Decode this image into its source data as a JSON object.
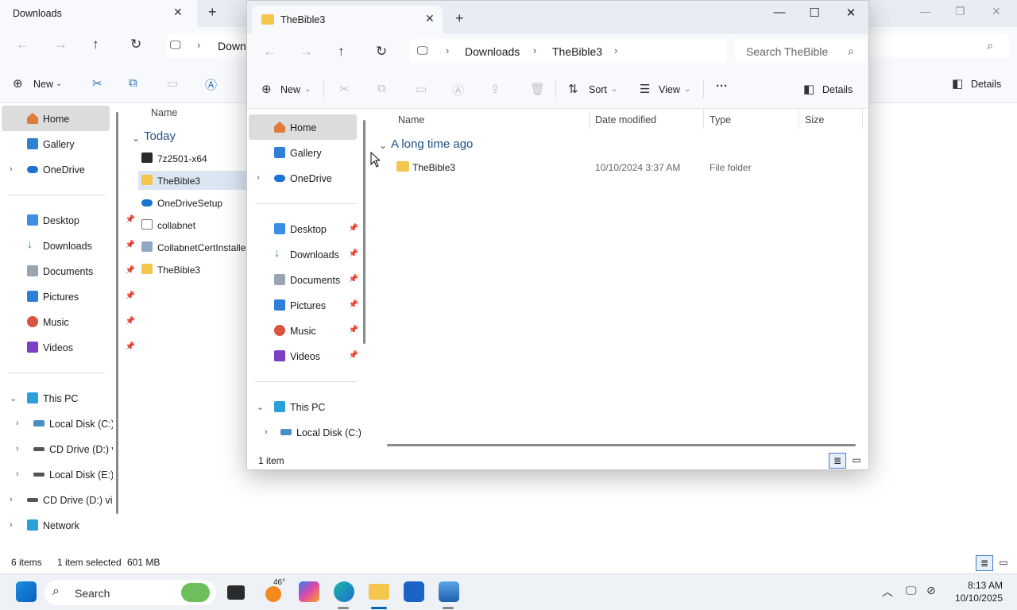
{
  "background_window": {
    "tab_title": "Downloads",
    "address_text": "Down",
    "toolbar": {
      "new_label": "New",
      "details_label": "Details"
    },
    "sidebar": {
      "home": "Home",
      "gallery": "Gallery",
      "onedrive": "OneDrive",
      "pinned": [
        "Desktop",
        "Downloads",
        "Documents",
        "Pictures",
        "Music",
        "Videos"
      ],
      "this_pc": "This PC",
      "drives": [
        "Local Disk (C:)",
        "CD Drive (D:) v",
        "Local Disk (E:)",
        "CD Drive (D:) vir"
      ],
      "network": "Network"
    },
    "list": {
      "column_name": "Name",
      "group": "Today",
      "files": [
        "7z2501-x64",
        "TheBible3",
        "OneDriveSetup",
        "collabnet",
        "CollabnetCertInstaller",
        "TheBible3"
      ]
    },
    "status": {
      "items": "6 items",
      "selected": "1 item selected",
      "size": "601 MB"
    }
  },
  "front_window": {
    "tab_title": "TheBible3",
    "breadcrumb": [
      "Downloads",
      "TheBible3"
    ],
    "search_placeholder": "Search TheBible",
    "toolbar": {
      "new_label": "New",
      "sort_label": "Sort",
      "view_label": "View",
      "details_label": "Details"
    },
    "sidebar": {
      "home": "Home",
      "gallery": "Gallery",
      "onedrive": "OneDrive",
      "pinned": [
        "Desktop",
        "Downloads",
        "Documents",
        "Pictures",
        "Music",
        "Videos"
      ],
      "this_pc": "This PC",
      "drives": [
        "Local Disk (C:)"
      ]
    },
    "columns": {
      "name": "Name",
      "date": "Date modified",
      "type": "Type",
      "size": "Size"
    },
    "group": "A long time ago",
    "rows": [
      {
        "name": "TheBible3",
        "date": "10/10/2024 3:37 AM",
        "type": "File folder",
        "size": ""
      }
    ],
    "status": {
      "items": "1 item"
    }
  },
  "taskbar": {
    "search_label": "Search",
    "weather_temp": "46°",
    "time": "8:13 AM",
    "date": "10/10/2025"
  },
  "colors": {
    "accent": "#0067c0",
    "folder": "#f4c64e",
    "selection": "#dbe6f3"
  }
}
